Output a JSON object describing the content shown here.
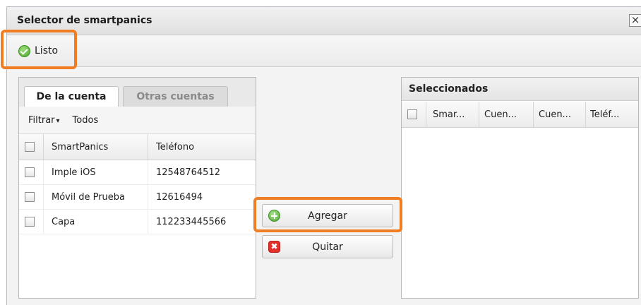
{
  "window": {
    "title": "Selector de smartpanics",
    "close_label": "×"
  },
  "toolbar": {
    "done_label": "Listo"
  },
  "tabs": [
    {
      "label": "De la cuenta",
      "active": true
    },
    {
      "label": "Otras cuentas",
      "active": false
    }
  ],
  "filter": {
    "label": "Filtrar",
    "arrow": "▾",
    "value": "Todos"
  },
  "left_grid": {
    "columns": [
      "SmartPanics",
      "Teléfono"
    ],
    "rows": [
      {
        "name": "Imple iOS",
        "phone": "12548764512"
      },
      {
        "name": "Móvil de Prueba",
        "phone": "12616494"
      },
      {
        "name": "Capa",
        "phone": "112233445566"
      }
    ]
  },
  "actions": {
    "add_label": "Agregar",
    "remove_label": "Quitar",
    "remove_glyph": "✖"
  },
  "right_grid": {
    "title": "Seleccionados",
    "columns": [
      "Smar...",
      "Cuen...",
      "Cuen...",
      "Teléf..."
    ]
  },
  "colors": {
    "highlight": "#f07d22",
    "ok_green": "#4aa82c",
    "remove_red": "#e2302b"
  },
  "icons": {
    "done": "check-circle-icon",
    "add": "plus-circle-icon",
    "remove": "x-square-icon",
    "close": "close-icon"
  }
}
